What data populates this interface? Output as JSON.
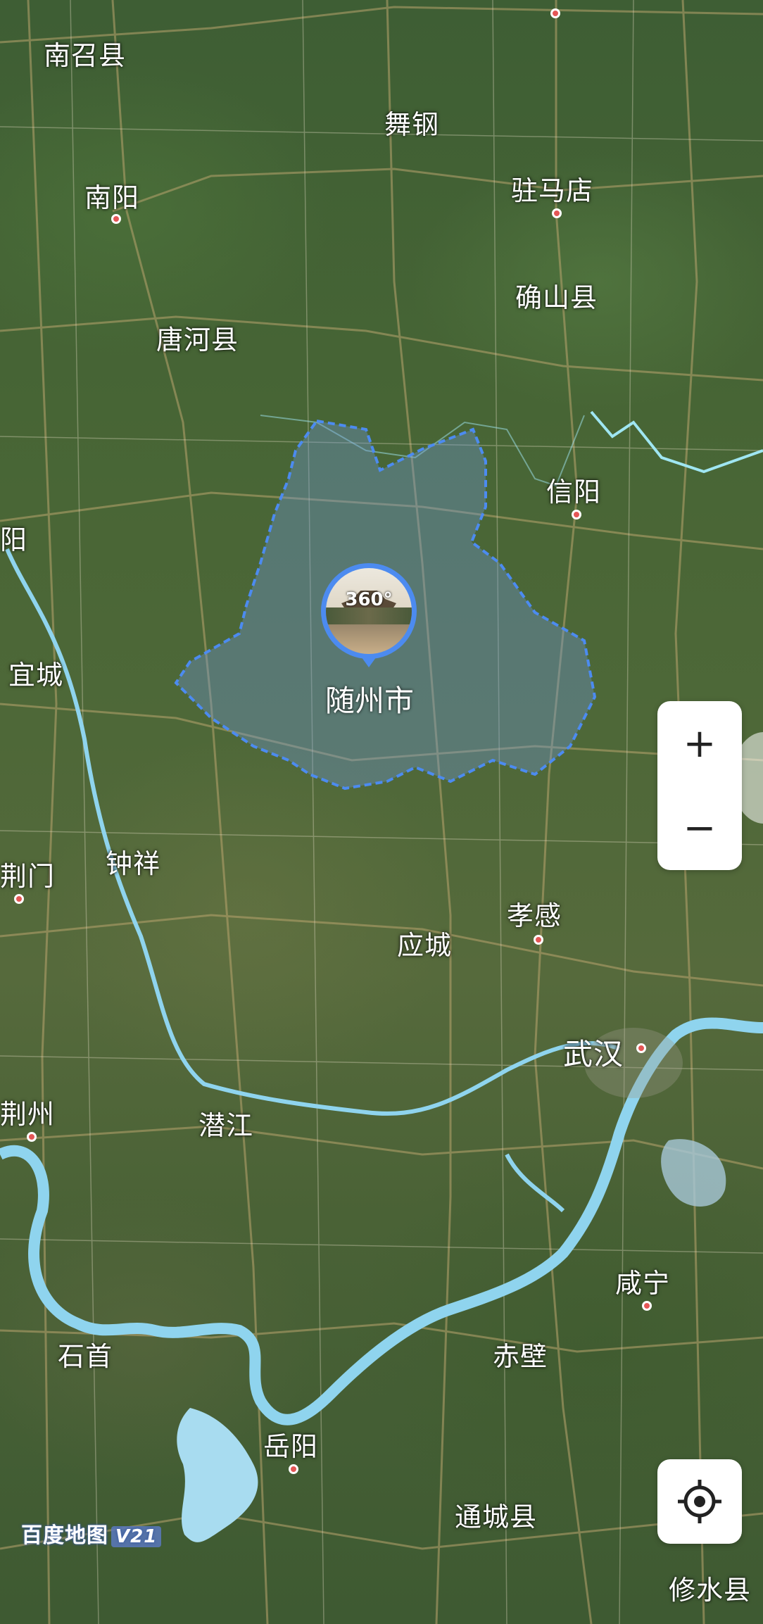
{
  "map": {
    "selected_region": "随州市",
    "panorama_badge": "360°",
    "labels": [
      {
        "id": "nanzhao",
        "text": "南召县"
      },
      {
        "id": "wugang",
        "text": "舞钢"
      },
      {
        "id": "nanyang",
        "text": "南阳"
      },
      {
        "id": "zhumadian",
        "text": "驻马店"
      },
      {
        "id": "queshan",
        "text": "确山县"
      },
      {
        "id": "tanghe",
        "text": "唐河县"
      },
      {
        "id": "xinyang",
        "text": "信阳"
      },
      {
        "id": "left-yang",
        "text": "阳"
      },
      {
        "id": "yicheng",
        "text": "宜城"
      },
      {
        "id": "zhongxiang",
        "text": "钟祥"
      },
      {
        "id": "jingmen",
        "text": "荆门"
      },
      {
        "id": "xiaogan",
        "text": "孝感"
      },
      {
        "id": "yingcheng",
        "text": "应城"
      },
      {
        "id": "wuhan",
        "text": "武汉"
      },
      {
        "id": "jingzhou",
        "text": "荆州"
      },
      {
        "id": "qianjiang",
        "text": "潜江"
      },
      {
        "id": "xianning",
        "text": "咸宁"
      },
      {
        "id": "shishou",
        "text": "石首"
      },
      {
        "id": "chibi",
        "text": "赤壁"
      },
      {
        "id": "yueyang",
        "text": "岳阳"
      },
      {
        "id": "tongcheng",
        "text": "通城县"
      },
      {
        "id": "xiushui",
        "text": "修水县"
      }
    ]
  },
  "controls": {
    "zoom_in": "+",
    "zoom_out": "−",
    "locate_icon": "locate-crosshair-icon"
  },
  "branding": {
    "logo_text": "百度地图",
    "version": "V21"
  },
  "colors": {
    "boundary": "#4c8bf0",
    "river": "#8fd4ee",
    "city_dot": "#e45656"
  }
}
